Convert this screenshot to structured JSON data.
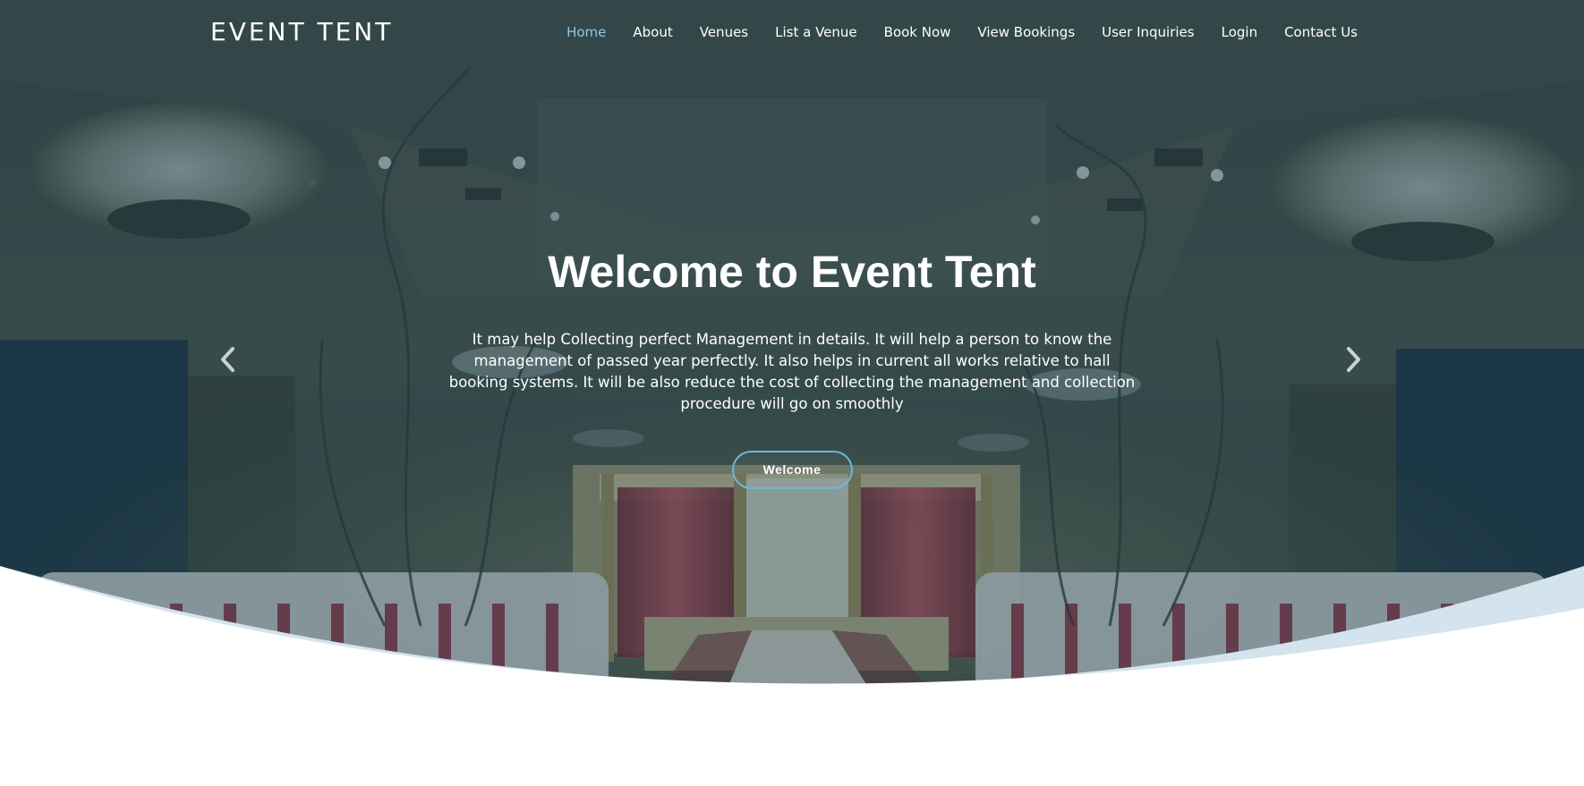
{
  "brand": {
    "name": "EVENT TENT"
  },
  "nav": {
    "items": [
      {
        "label": "Home",
        "active": true
      },
      {
        "label": "About"
      },
      {
        "label": "Venues"
      },
      {
        "label": "List a Venue"
      },
      {
        "label": "Book Now"
      },
      {
        "label": "View Bookings"
      },
      {
        "label": "User Inquiries"
      },
      {
        "label": "Login"
      },
      {
        "label": "Contact Us"
      }
    ],
    "active_color": "#8ec6e6"
  },
  "hero": {
    "title": "Welcome to Event Tent",
    "description": "It may help Collecting perfect Management in details. It will help a person to know the management of passed year perfectly. It also helps in current all works relative to hall booking systems. It will be also reduce the cost of collecting the management and collection procedure will go on smoothly",
    "button_label": "Welcome",
    "overlay_color": "#1c3a4a",
    "wave_color": "#d3e4ee"
  },
  "carousel": {
    "prev_icon": "chevron-left-icon",
    "next_icon": "chevron-right-icon"
  }
}
